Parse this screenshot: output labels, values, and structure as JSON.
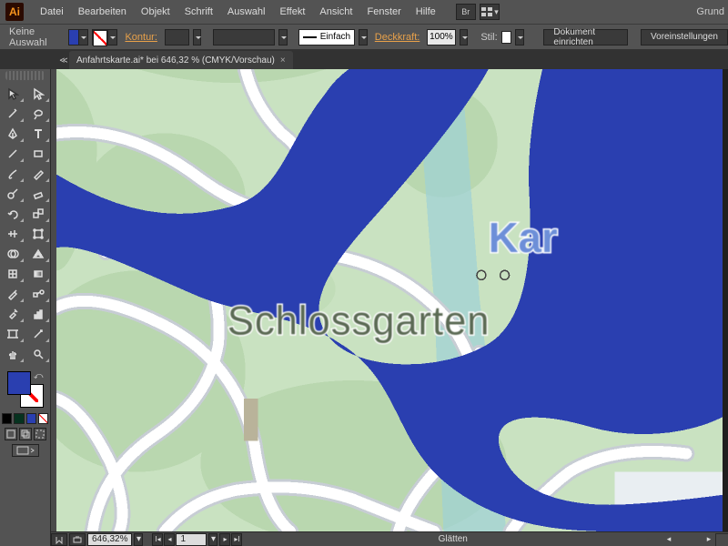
{
  "app": {
    "icon_text": "Ai",
    "right_label": "Grund"
  },
  "menu": {
    "items": [
      "Datei",
      "Bearbeiten",
      "Objekt",
      "Schrift",
      "Auswahl",
      "Effekt",
      "Ansicht",
      "Fenster",
      "Hilfe"
    ],
    "br_btn": "Br"
  },
  "controlbar": {
    "selection_label": "Keine Auswahl",
    "fill_color": "#2a3fb0",
    "stroke_link": "Kontur:",
    "stroke_style_label": "Einfach",
    "opacity_link": "Deckkraft:",
    "opacity_value": "100%",
    "style_label": "Stil:",
    "btn_doc_setup": "Dokument einrichten",
    "btn_prefs": "Voreinstellungen"
  },
  "document": {
    "tab_title": "Anfahrtskarte.ai* bei 646,32 % (CMYK/Vorschau)"
  },
  "canvas": {
    "labels": {
      "schlossgarten": "Schlossgarten",
      "partial_right": "Kar"
    },
    "colors": {
      "park": "#c9e2c1",
      "grass_dark": "#b9d7af",
      "road": "#ffffff",
      "road_stroke": "#c7cdd4",
      "river_overlay": "#9ed1d5",
      "blue_shape": "#2a3fb0"
    }
  },
  "fillstroke": {
    "fill": "#2a3fb0"
  },
  "swatches": {
    "row": [
      "#000000",
      "#06321f",
      "#2a3fb0"
    ]
  },
  "status": {
    "zoom": "646,32%",
    "artboard": "1",
    "tool_hint": "Glätten"
  }
}
